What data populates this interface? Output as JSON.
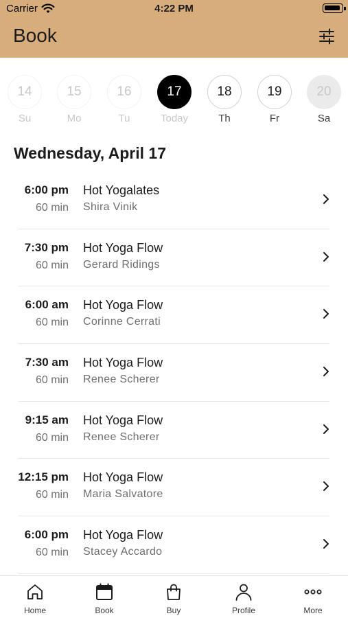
{
  "status_bar": {
    "carrier": "Carrier",
    "time": "4:22 PM"
  },
  "header": {
    "title": "Book"
  },
  "days": [
    {
      "number": "14",
      "label": "Su",
      "state": "past"
    },
    {
      "number": "15",
      "label": "Mo",
      "state": "past"
    },
    {
      "number": "16",
      "label": "Tu",
      "state": "past"
    },
    {
      "number": "17",
      "label": "Today",
      "state": "today"
    },
    {
      "number": "18",
      "label": "Th",
      "state": "future"
    },
    {
      "number": "19",
      "label": "Fr",
      "state": "future"
    },
    {
      "number": "20",
      "label": "Sa",
      "state": "disabled"
    }
  ],
  "date_heading": "Wednesday, April 17",
  "classes": [
    {
      "time": "6:00 pm",
      "duration": "60 min",
      "name": "Hot Yogalates",
      "instructor": "Shira Vinik"
    },
    {
      "time": "7:30 pm",
      "duration": "60 min",
      "name": "Hot Yoga Flow",
      "instructor": "Gerard Ridings"
    },
    {
      "time": "6:00 am",
      "duration": "60 min",
      "name": "Hot Yoga Flow",
      "instructor": "Corinne Cerrati"
    },
    {
      "time": "7:30 am",
      "duration": "60 min",
      "name": "Hot Yoga Flow",
      "instructor": "Renee Scherer"
    },
    {
      "time": "9:15 am",
      "duration": "60 min",
      "name": "Hot Yoga Flow",
      "instructor": "Renee Scherer"
    },
    {
      "time": "12:15 pm",
      "duration": "60 min",
      "name": "Hot Yoga Flow",
      "instructor": "Maria Salvatore"
    },
    {
      "time": "6:00 pm",
      "duration": "60 min",
      "name": "Hot Yoga Flow",
      "instructor": "Stacey Accardo"
    }
  ],
  "tabs": [
    {
      "label": "Home",
      "icon": "home-icon"
    },
    {
      "label": "Book",
      "icon": "calendar-icon"
    },
    {
      "label": "Buy",
      "icon": "shopping-bag-icon"
    },
    {
      "label": "Profile",
      "icon": "person-icon"
    },
    {
      "label": "More",
      "icon": "more-icon"
    }
  ],
  "colors": {
    "header_bg": "#d8ad7c",
    "selected_day": "#000000",
    "secondary_text": "#6e6e73"
  }
}
